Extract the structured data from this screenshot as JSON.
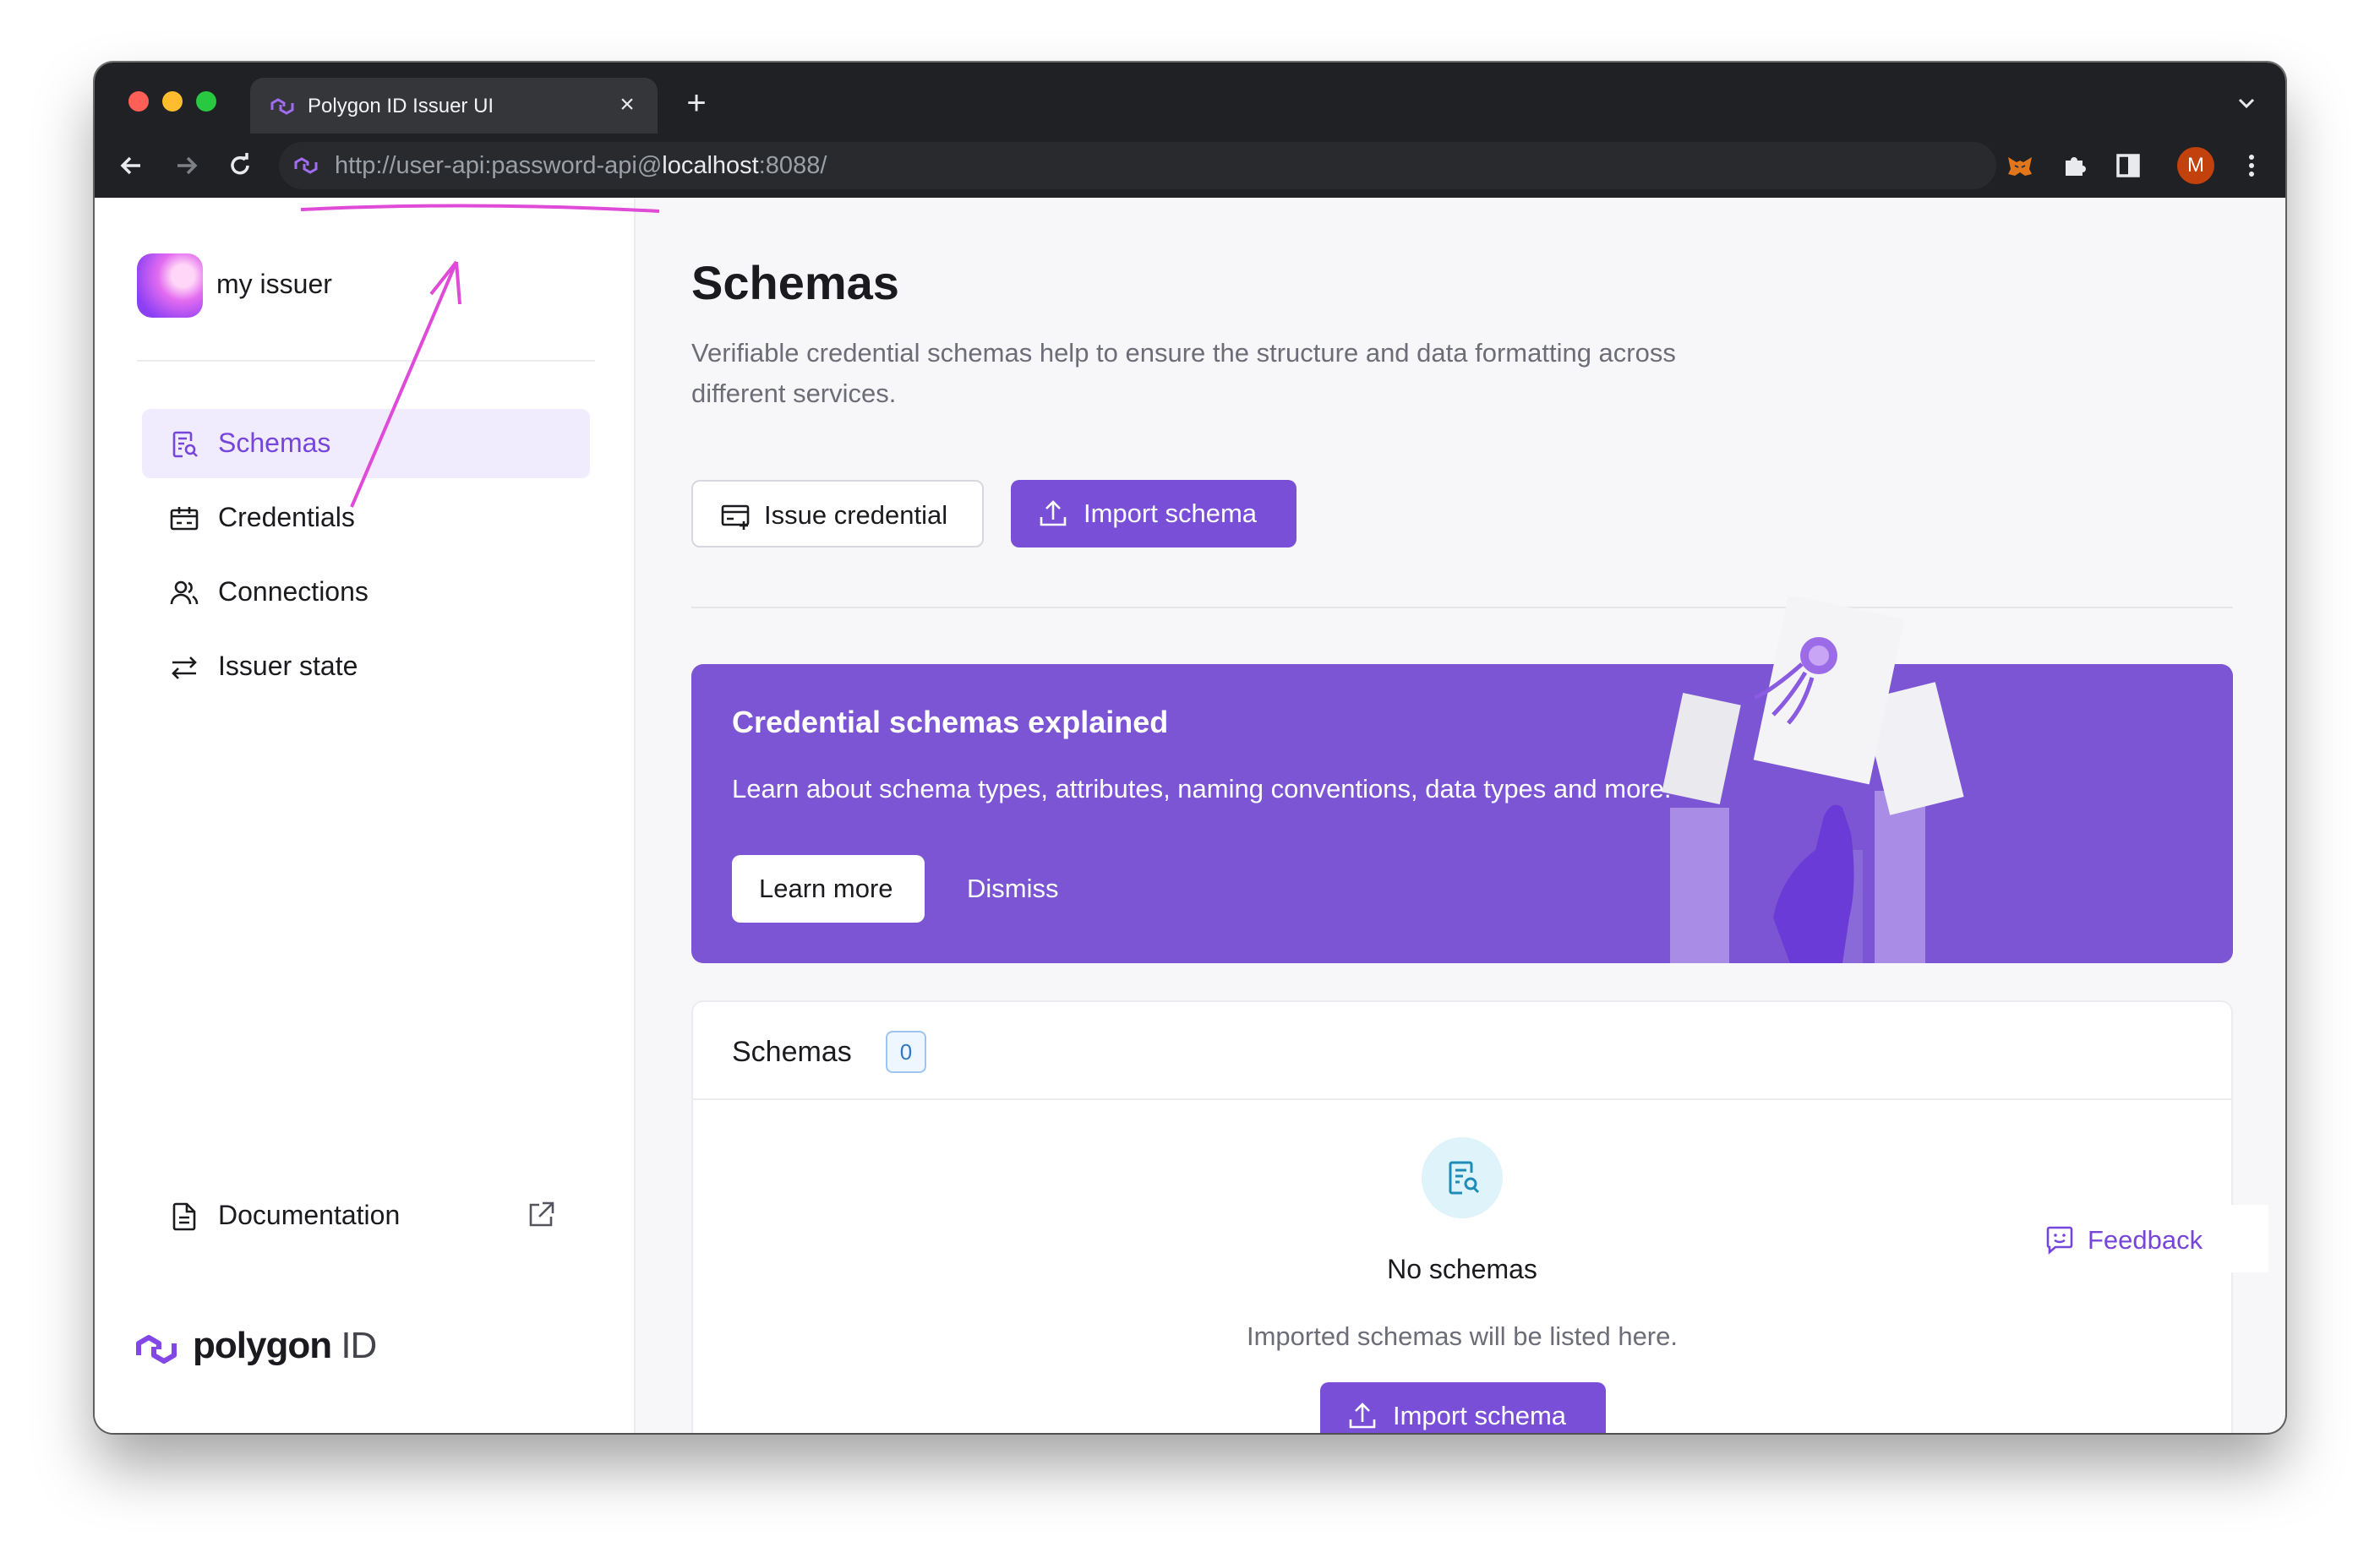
{
  "browser": {
    "tab_title": "Polygon ID Issuer UI",
    "url_prefix": "http://user-api:password-api@",
    "url_host": "localhost",
    "url_suffix": ":8088/",
    "profile_initial": "M"
  },
  "sidebar": {
    "issuer_name": "my issuer",
    "items": [
      {
        "label": "Schemas",
        "icon": "schema-icon",
        "active": true
      },
      {
        "label": "Credentials",
        "icon": "credential-icon",
        "active": false
      },
      {
        "label": "Connections",
        "icon": "users-icon",
        "active": false
      },
      {
        "label": "Issuer state",
        "icon": "arrows-swap-icon",
        "active": false
      }
    ],
    "documentation_label": "Documentation",
    "logo_word": "polygon",
    "logo_id": "ID"
  },
  "main": {
    "title": "Schemas",
    "description": "Verifiable credential schemas help to ensure the structure and data formatting across different services.",
    "issue_credential_label": "Issue credential",
    "import_schema_label": "Import schema"
  },
  "banner": {
    "title": "Credential schemas explained",
    "text": "Learn about schema types, attributes, naming conventions, data types and more.",
    "learn_more_label": "Learn more",
    "dismiss_label": "Dismiss"
  },
  "schemas_card": {
    "title": "Schemas",
    "count": "0",
    "empty_title": "No schemas",
    "empty_description": "Imported schemas will be listed here.",
    "import_label": "Import schema"
  },
  "feedback_label": "Feedback",
  "colors": {
    "accent": "#7a4fd8",
    "banner": "#7b55d3",
    "annotation": "#e04ad8"
  }
}
